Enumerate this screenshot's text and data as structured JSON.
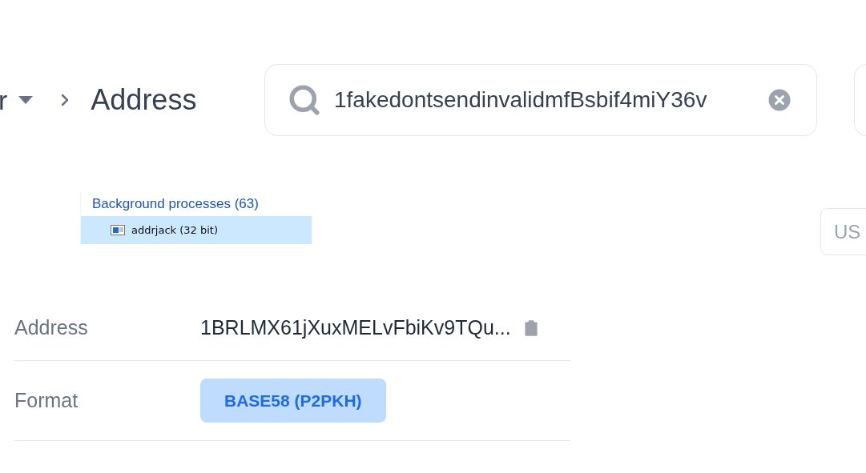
{
  "breadcrumb": {
    "parent": "r",
    "current": "Address"
  },
  "search": {
    "value": "1fakedontsendinvalidmfBsbif4miY36v"
  },
  "process_list": {
    "group": "Background processes (63)",
    "items": [
      {
        "name": "addrjack (32 bit)",
        "selected": true
      }
    ]
  },
  "currency_button": "US",
  "details": [
    {
      "label": "Address",
      "kind": "copy",
      "value": "1BRLMX61jXuxMELvFbiKv9TQu..."
    },
    {
      "label": "Format",
      "kind": "badge",
      "value": "BASE58 (P2PKH)"
    }
  ]
}
